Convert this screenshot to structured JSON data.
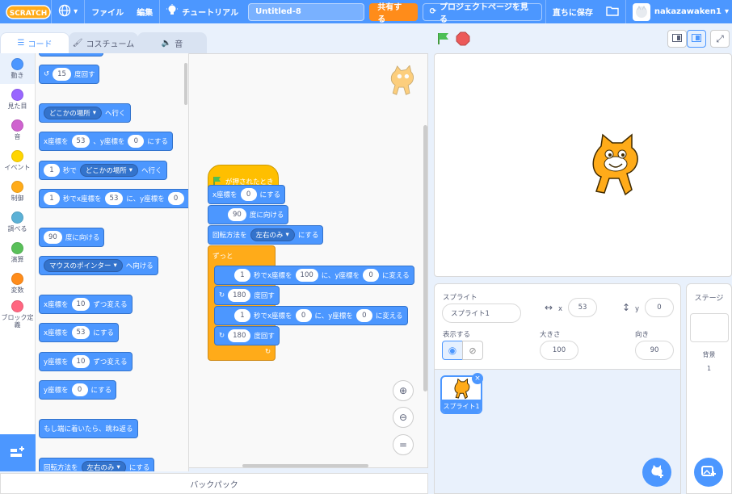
{
  "menu": {
    "logo": "SCRATCH",
    "file": "ファイル",
    "edit": "編集",
    "tutorial": "チュートリアル",
    "project_title": "Untitled-8",
    "share": "共有する",
    "project_page": "プロジェクトページを見る",
    "save_now": "直ちに保存",
    "username": "nakazawaken1"
  },
  "tabs": {
    "code": "コード",
    "costume": "コスチューム",
    "sound": "音"
  },
  "categories": [
    {
      "label": "動き",
      "color": "#4c97ff"
    },
    {
      "label": "見た目",
      "color": "#9966ff"
    },
    {
      "label": "音",
      "color": "#cf63cf"
    },
    {
      "label": "イベント",
      "color": "#ffd500"
    },
    {
      "label": "制御",
      "color": "#ffab19"
    },
    {
      "label": "調べる",
      "color": "#5cb1d6"
    },
    {
      "label": "演算",
      "color": "#59c059"
    },
    {
      "label": "変数",
      "color": "#ff8c1a"
    },
    {
      "label": "ブロック定義",
      "color": "#ff6680"
    }
  ],
  "palette": {
    "turn_left_val": "15",
    "turn_left_txt": "度回す",
    "goto_dd": "どこかの場所",
    "goto_txt": "へ行く",
    "gotoxy_x_lbl": "x座標を",
    "gotoxy_x": "53",
    "gotoxy_mid": "、y座標を",
    "gotoxy_y": "0",
    "gotoxy_end": "にする",
    "glide_sec": "1",
    "glide_mid": "秒で",
    "glide_dd": "どこかの場所",
    "glide_end": "へ行く",
    "glidexy_sec": "1",
    "glidexy_mid": "秒でx座標を",
    "glidexy_x": "53",
    "glidexy_mid2": "に、y座標を",
    "glidexy_y": "0",
    "point_val": "90",
    "point_txt": "度に向ける",
    "pointto_dd": "マウスのポインター",
    "pointto_txt": "へ向ける",
    "changex_lbl": "x座標を",
    "changex_val": "10",
    "changex_txt": "ずつ変える",
    "setx_lbl": "x座標を",
    "setx_val": "53",
    "setx_txt": "にする",
    "changey_lbl": "y座標を",
    "changey_val": "10",
    "changey_txt": "ずつ変える",
    "sety_lbl": "y座標を",
    "sety_val": "0",
    "sety_txt": "にする",
    "bounce": "もし端に着いたら、跳ね返る",
    "rot_lbl": "回転方法を",
    "rot_dd": "左右のみ",
    "rot_txt": "にする"
  },
  "script": {
    "hat": "が押されたとき",
    "set_x_lbl": "x座標を",
    "set_x_val": "0",
    "set_x_txt": "にする",
    "point_val": "90",
    "point_txt": "度に向ける",
    "rot_lbl": "回転方法を",
    "rot_dd": "左右のみ",
    "rot_txt": "にする",
    "forever": "ずっと",
    "g1_sec": "1",
    "g1_mid": "秒でx座標を",
    "g1_x": "100",
    "g1_mid2": "に、y座標を",
    "g1_y": "0",
    "g1_end": "に変える",
    "t1_val": "180",
    "t1_txt": "度回す",
    "g2_sec": "1",
    "g2_mid": "秒でx座標を",
    "g2_x": "0",
    "g2_mid2": "に、y座標を",
    "g2_y": "0",
    "g2_end": "に変える",
    "t2_val": "180",
    "t2_txt": "度回す"
  },
  "backpack": "バックパック",
  "sprite_info": {
    "sprite_label": "スプライト",
    "sprite_name": "スプライト1",
    "x_label": "x",
    "x_val": "53",
    "y_label": "y",
    "y_val": "0",
    "show_label": "表示する",
    "size_label": "大きさ",
    "size_val": "100",
    "dir_label": "向き",
    "dir_val": "90"
  },
  "sprite_list": [
    {
      "name": "スプライト1"
    }
  ],
  "stage_pane": {
    "title": "ステージ",
    "backdrop_label": "背景",
    "backdrop_count": "1"
  }
}
